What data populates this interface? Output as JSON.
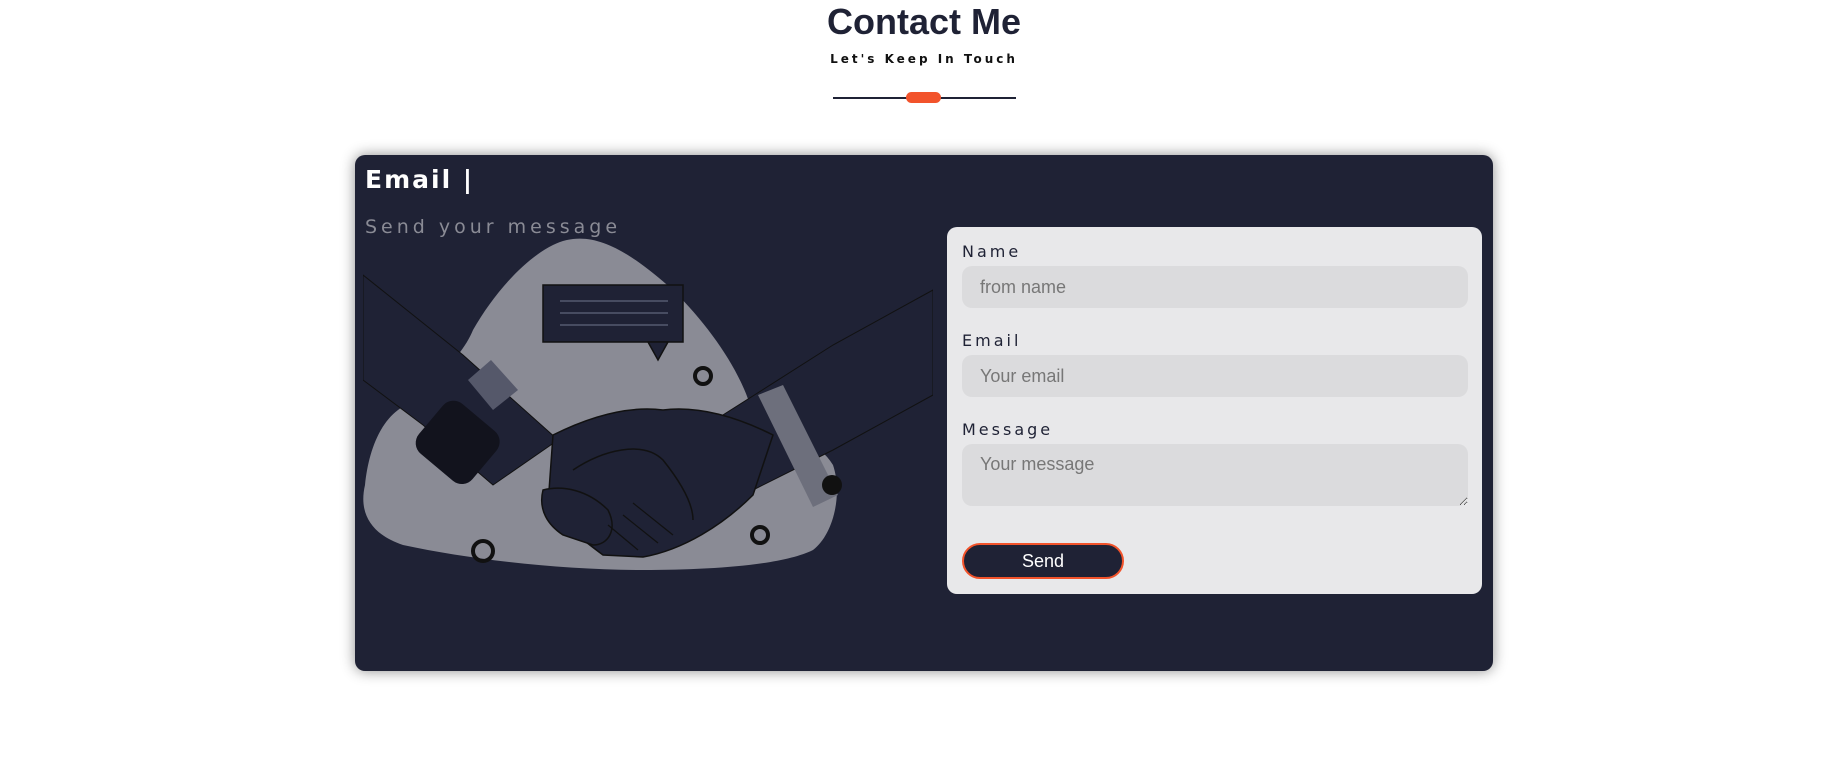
{
  "header": {
    "title": "Contact Me",
    "subtitle": "Let's Keep In Touch"
  },
  "card": {
    "title": "Email |",
    "subtitle": "Send your message"
  },
  "form": {
    "name_label": "Name",
    "name_placeholder": "from name",
    "email_label": "Email",
    "email_placeholder": "Your email",
    "message_label": "Message",
    "message_placeholder": "Your message",
    "send_label": "Send"
  },
  "colors": {
    "accent": "#f2532b",
    "navy": "#1f2235",
    "panel": "#e8e8ea",
    "field": "#dbdbdd"
  },
  "icons": {
    "illustration": "handshake-illustration"
  }
}
